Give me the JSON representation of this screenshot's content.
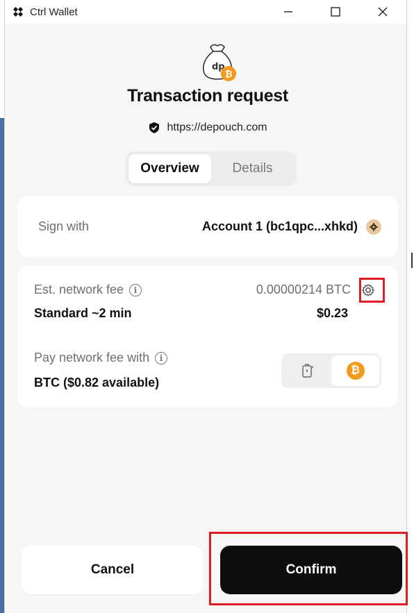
{
  "window": {
    "title": "Ctrl Wallet",
    "minimize_icon": "minimize-icon",
    "maximize_icon": "maximize-icon",
    "close_icon": "close-icon"
  },
  "header": {
    "logo_icon": "depouch-money-bag-icon",
    "title": "Transaction request",
    "url": "https://depouch.com"
  },
  "tabs": [
    {
      "label": "Overview",
      "active": true
    },
    {
      "label": "Details",
      "active": false
    }
  ],
  "sign": {
    "label": "Sign with",
    "account": "Account 1 (bc1qpc...xhkd)"
  },
  "fee": {
    "label": "Est. network fee",
    "btc_amount": "0.00000214 BTC",
    "speed": "Standard ~2 min",
    "usd_amount": "$0.23",
    "pay_label": "Pay network fee with",
    "pay_value": "BTC ($0.82  available)",
    "pay_options": [
      "fuel-icon",
      "bitcoin-icon"
    ],
    "pay_selected": "bitcoin-icon"
  },
  "actions": {
    "cancel_label": "Cancel",
    "confirm_label": "Confirm"
  },
  "colors": {
    "accent_dark": "#0d0f0c",
    "bitcoin_orange": "#f39a1f",
    "highlight_red": "#e01b24",
    "background": "#f6f6f5"
  }
}
